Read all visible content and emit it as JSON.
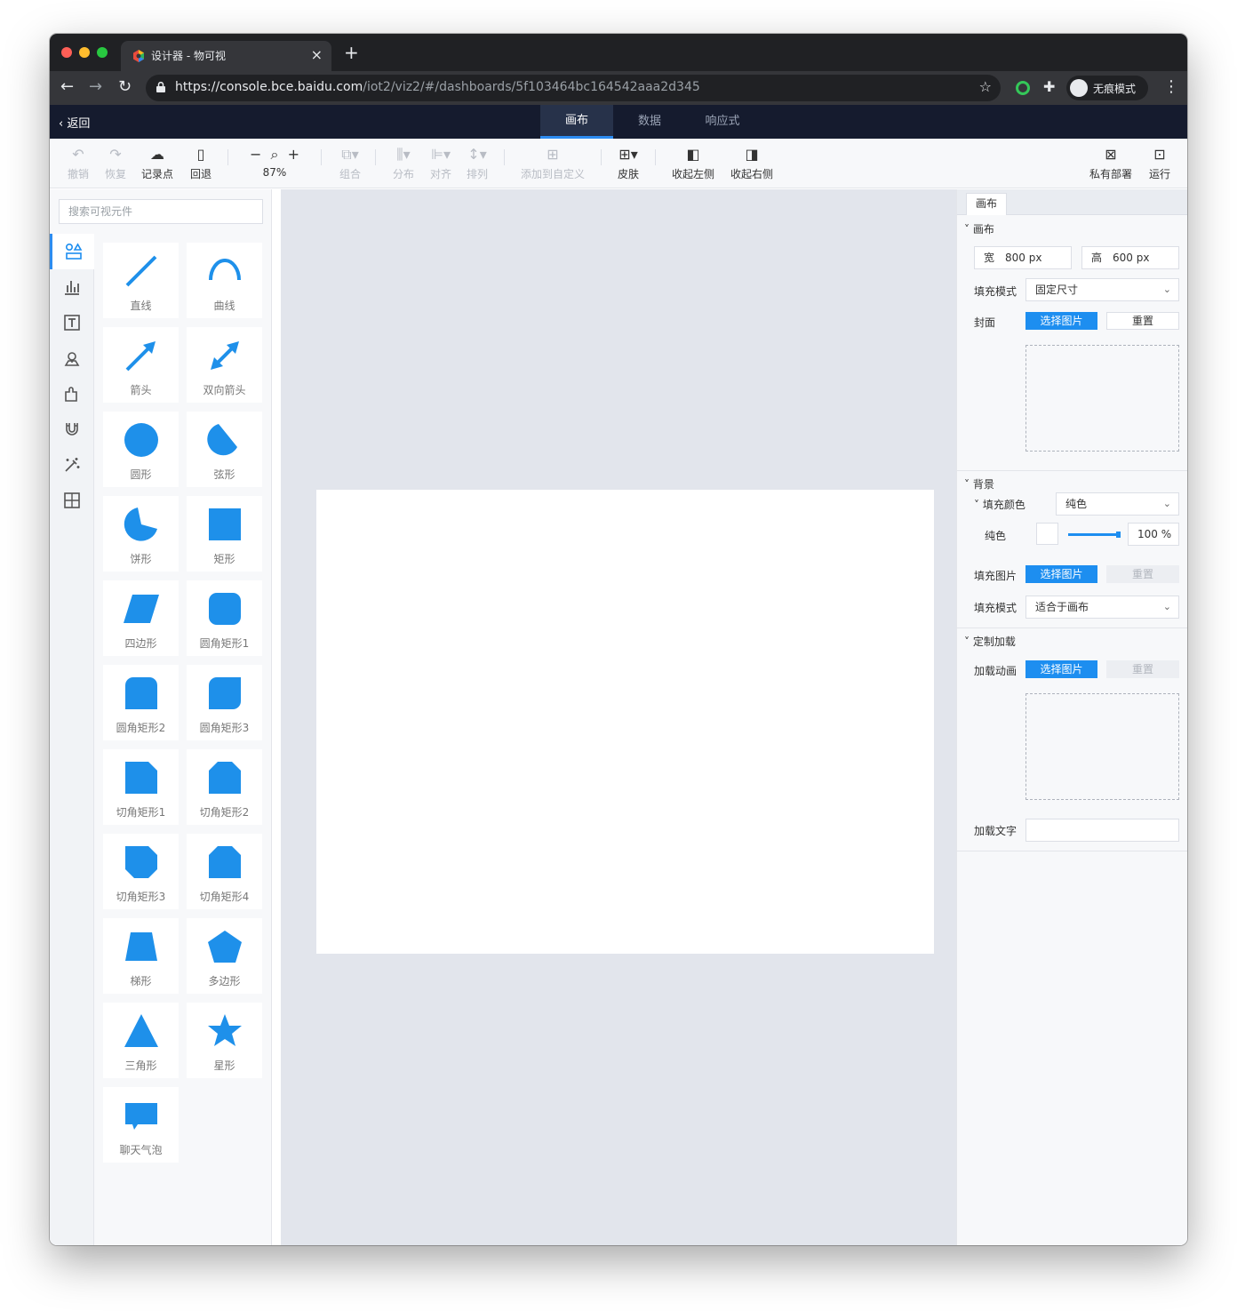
{
  "browser": {
    "tab_title": "设计器 - 物可视",
    "close_glyph": "×",
    "new_tab_glyph": "+",
    "url_host": "https://console.bce.baidu.com",
    "url_path": "/iot2/viz2/#/dashboards/5f103464bc164542aaa2d345",
    "incognito_label": "无痕模式"
  },
  "header": {
    "back_label": "返回",
    "tabs": [
      {
        "label": "画布",
        "active": true
      },
      {
        "label": "数据",
        "active": false
      },
      {
        "label": "响应式",
        "active": false
      }
    ]
  },
  "toolbar": {
    "undo": "撤销",
    "redo": "恢复",
    "checkpoint": "记录点",
    "rollback": "回退",
    "zoom": "87%",
    "group": "组合",
    "distribute": "分布",
    "align": "对齐",
    "arrange": "排列",
    "add_custom": "添加到自定义",
    "skin": "皮肤",
    "collapse_left": "收起左侧",
    "collapse_right": "收起右侧",
    "private_deploy": "私有部署",
    "run": "运行"
  },
  "left_panel": {
    "search_placeholder": "搜索可视元件",
    "categories": [
      "shapes-icon",
      "chart-icon",
      "text-icon",
      "map-pin-icon",
      "puzzle-icon",
      "magnet-icon",
      "magic-wand-icon",
      "custom-grid-icon"
    ],
    "components": [
      {
        "name": "直线",
        "icon": "line-icon"
      },
      {
        "name": "曲线",
        "icon": "curve-icon"
      },
      {
        "name": "箭头",
        "icon": "arrow-icon"
      },
      {
        "name": "双向箭头",
        "icon": "double-arrow-icon"
      },
      {
        "name": "圆形",
        "icon": "circle-icon"
      },
      {
        "name": "弦形",
        "icon": "chord-icon"
      },
      {
        "name": "饼形",
        "icon": "pie-icon"
      },
      {
        "name": "矩形",
        "icon": "rectangle-icon"
      },
      {
        "name": "四边形",
        "icon": "parallelogram-icon"
      },
      {
        "name": "圆角矩形1",
        "icon": "rounded-rect-1-icon"
      },
      {
        "name": "圆角矩形2",
        "icon": "rounded-rect-2-icon"
      },
      {
        "name": "圆角矩形3",
        "icon": "rounded-rect-3-icon"
      },
      {
        "name": "切角矩形1",
        "icon": "cut-rect-1-icon"
      },
      {
        "name": "切角矩形2",
        "icon": "cut-rect-2-icon"
      },
      {
        "name": "切角矩形3",
        "icon": "cut-rect-3-icon"
      },
      {
        "name": "切角矩形4",
        "icon": "cut-rect-4-icon"
      },
      {
        "name": "梯形",
        "icon": "trapezoid-icon"
      },
      {
        "name": "多边形",
        "icon": "pentagon-icon"
      },
      {
        "name": "三角形",
        "icon": "triangle-icon"
      },
      {
        "name": "星形",
        "icon": "star-icon"
      },
      {
        "name": "聊天气泡",
        "icon": "chat-bubble-icon"
      }
    ]
  },
  "right_panel": {
    "tab": "画布",
    "canvas_section": {
      "title": "画布",
      "width_label": "宽",
      "width_value": "800 px",
      "height_label": "高",
      "height_value": "600 px",
      "fill_mode_label": "填充模式",
      "fill_mode_value": "固定尺寸",
      "cover_label": "封面",
      "select_image": "选择图片",
      "reset": "重置"
    },
    "background_section": {
      "title": "背景",
      "fill_color_label": "填充颜色",
      "fill_color_value": "纯色",
      "solid_label": "纯色",
      "opacity_value": "100 %",
      "opacity_fraction": 1.0,
      "fill_image_label": "填充图片",
      "select_image": "选择图片",
      "reset": "重置",
      "fill_mode_label": "填充模式",
      "fill_mode_value": "适合于画布"
    },
    "loading_section": {
      "title": "定制加载",
      "animation_label": "加载动画",
      "select_image": "选择图片",
      "reset": "重置",
      "text_label": "加载文字",
      "text_value": ""
    }
  },
  "colors": {
    "accent": "#1d8ef0",
    "shape_fill": "#1e90ea",
    "header_bg": "#151b2e",
    "canvas_bg": "#e2e5ec"
  }
}
